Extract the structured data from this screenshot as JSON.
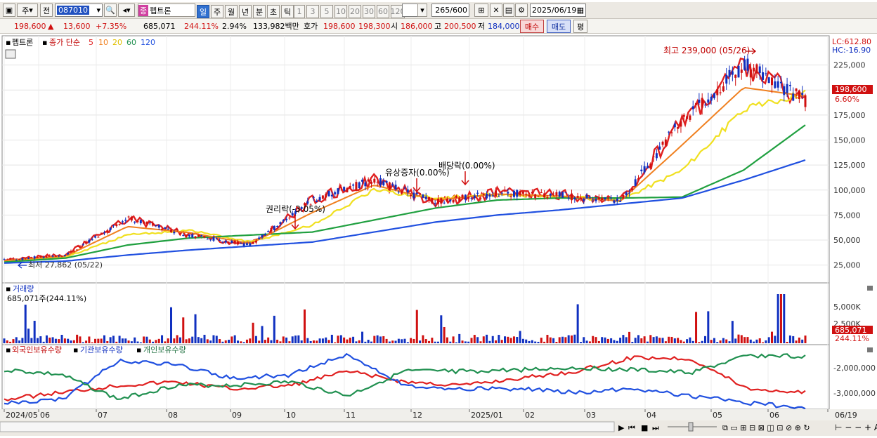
{
  "toolbar": {
    "period_label": "주",
    "prev_label": "전",
    "stock_code": "087010",
    "stock_name": "펩트론",
    "stock_badge": "종",
    "timeframes": [
      "일",
      "주",
      "월",
      "년",
      "분",
      "초",
      "틱"
    ],
    "intervals": [
      "1",
      "3",
      "5",
      "10",
      "20",
      "30",
      "60",
      "120"
    ],
    "count_value": "265",
    "count_max": "/600",
    "date_value": "2025/06/19"
  },
  "quote": {
    "price": "198,600",
    "change_arrow": "▲",
    "change": "13,600",
    "change_pct": "+7.35%",
    "volume": "685,071",
    "volume_ratio": "244.11%",
    "turnover_rate": "2.94%",
    "amount": "133,982백만",
    "ask_label": "호가",
    "ask": "198,600",
    "bid": "198,300",
    "open_label": "시",
    "open": "186,000",
    "high_label": "고",
    "high": "200,500",
    "low_label": "저",
    "low": "184,000",
    "buy_label": "매수",
    "sell_label": "매도",
    "eval_label": "평"
  },
  "price_panel": {
    "stock_tag": "펩트론",
    "indicator_title": "종가 단순",
    "ma_periods": [
      "5",
      "10",
      "20",
      "60",
      "120"
    ],
    "ma_colors": [
      "#e02020",
      "#f08020",
      "#f0e020",
      "#20a040",
      "#2050e0"
    ],
    "lc_label": "LC:612.80",
    "hc_label": "HC:-16.90",
    "high_note": "최고 239,000 (05/26)",
    "low_note": "최저 27,862 (05/22)",
    "cur_price_tag": "198,600",
    "cur_pct_tag": "6.60%",
    "y_ticks": [
      "225,000",
      "200,000",
      "175,000",
      "150,000",
      "125,000",
      "100,000",
      "75,000",
      "50,000",
      "25,000"
    ],
    "events": [
      {
        "label": "권리락(-3.05%)"
      },
      {
        "label": "유상증자(0.00%)"
      },
      {
        "label": "배당락(0.00%)"
      }
    ]
  },
  "volume_panel": {
    "title": "거래량",
    "value_text": "685,071주(244.11%)",
    "y_ticks": [
      "5,000K",
      "2,500K"
    ],
    "cur_tag": "685,071",
    "cur_pct": "244.11%"
  },
  "holding_panel": {
    "series": [
      {
        "name": "외국인보유수량",
        "color": "#e02020"
      },
      {
        "name": "기관보유수량",
        "color": "#2050e0"
      },
      {
        "name": "개인보유수량",
        "color": "#209050"
      }
    ],
    "y_ticks": [
      "-2,000,000",
      "-3,000,000"
    ]
  },
  "x_axis": {
    "labels": [
      "2024/05",
      "06",
      "07",
      "08",
      "09",
      "10",
      "11",
      "12",
      "2025/01",
      "02",
      "03",
      "04",
      "05",
      "06",
      "06/19"
    ]
  },
  "chart_data": [
    {
      "type": "line",
      "title": "펩트론 종가 단순",
      "x": [
        "2024/05",
        "2024/06",
        "2024/07",
        "2024/08",
        "2024/09",
        "2024/10",
        "2024/11",
        "2024/12",
        "2025/01",
        "2025/02",
        "2025/03",
        "2025/04",
        "2025/05",
        "2025/06"
      ],
      "series": [
        {
          "name": "5",
          "values": [
            30000,
            35000,
            72000,
            55000,
            45000,
            90000,
            110000,
            88000,
            97000,
            95000,
            88000,
            170000,
            225000,
            190000
          ]
        },
        {
          "name": "20",
          "values": [
            29000,
            33000,
            55000,
            60000,
            48000,
            65000,
            100000,
            92000,
            95000,
            93000,
            90000,
            120000,
            180000,
            198000
          ]
        },
        {
          "name": "60",
          "values": [
            28000,
            32000,
            45000,
            52000,
            55000,
            58000,
            70000,
            82000,
            90000,
            92000,
            92000,
            93000,
            120000,
            165000
          ]
        },
        {
          "name": "120",
          "values": [
            27000,
            29000,
            35000,
            40000,
            44000,
            48000,
            58000,
            68000,
            75000,
            80000,
            86000,
            92000,
            110000,
            130000
          ]
        }
      ],
      "ylim": [
        10000,
        250000
      ]
    },
    {
      "type": "bar",
      "title": "거래량",
      "ylim": [
        0,
        6000000
      ]
    }
  ]
}
